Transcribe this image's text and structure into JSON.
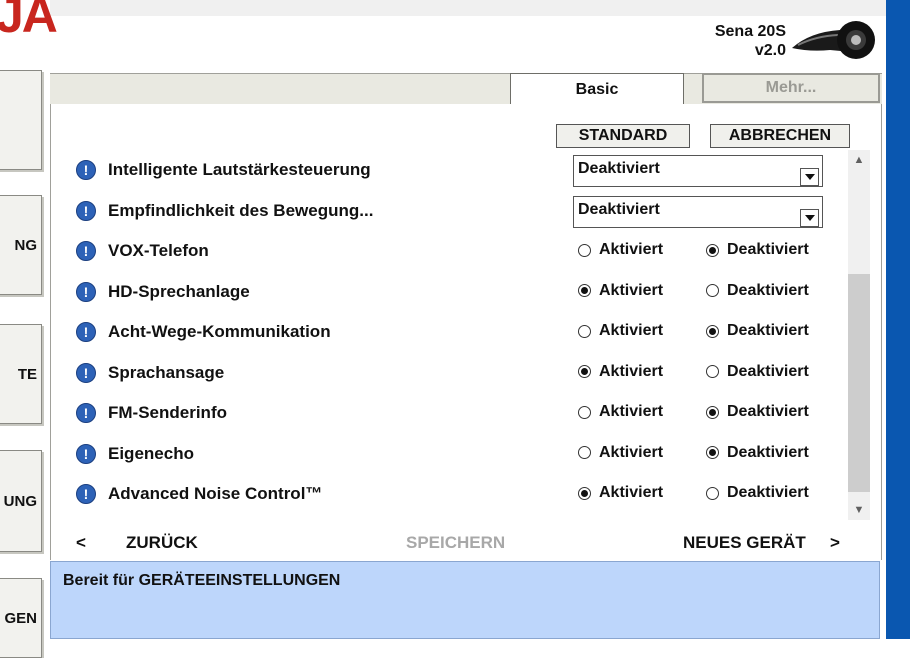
{
  "app": {
    "logo_text": "JA",
    "device_name": "Sena 20S",
    "device_version": "v2.0",
    "helmet_icon": "headset-device-icon"
  },
  "sidebar": {
    "items": [
      {
        "label": ""
      },
      {
        "label": "NG"
      },
      {
        "label": "TE"
      },
      {
        "label": "UNG"
      },
      {
        "label": "GEN"
      }
    ]
  },
  "tabs": [
    {
      "label": "Basic",
      "active": true
    },
    {
      "label": "Mehr...",
      "active": false
    }
  ],
  "toolbar": {
    "standard_label": "STANDARD",
    "cancel_label": "ABBRECHEN"
  },
  "settings": [
    {
      "label": "Intelligente Lautstärkesteuerung",
      "type": "select",
      "value": "Deaktiviert"
    },
    {
      "label": "Empfindlichkeit des Bewegung...",
      "type": "select",
      "value": "Deaktiviert"
    },
    {
      "label": "VOX-Telefon",
      "type": "radio",
      "value": "Deaktiviert"
    },
    {
      "label": "HD-Sprechanlage",
      "type": "radio",
      "value": "Aktiviert"
    },
    {
      "label": "Acht-Wege-Kommunikation",
      "type": "radio",
      "value": "Deaktiviert"
    },
    {
      "label": "Sprachansage",
      "type": "radio",
      "value": "Aktiviert"
    },
    {
      "label": "FM-Senderinfo",
      "type": "radio",
      "value": "Deaktiviert"
    },
    {
      "label": "Eigenecho",
      "type": "radio",
      "value": "Deaktiviert"
    },
    {
      "label": "Advanced Noise Control™",
      "type": "radio",
      "value": "Aktiviert"
    }
  ],
  "options": {
    "on": "Aktiviert",
    "off": "Deaktiviert"
  },
  "info_glyph": "!",
  "nav": {
    "back_arrow": "<",
    "back_label": "ZURÜCK",
    "save_label": "SPEICHERN",
    "new_device_label": "NEUES GERÄT",
    "next_arrow": ">"
  },
  "status": {
    "text": "Bereit für GERÄTEEINSTELLUNGEN"
  },
  "colors": {
    "accent_blue": "#0a57b0",
    "status_bg": "#bdd6fb",
    "info_icon": "#2d62b7",
    "logo_red": "#c8261e"
  }
}
